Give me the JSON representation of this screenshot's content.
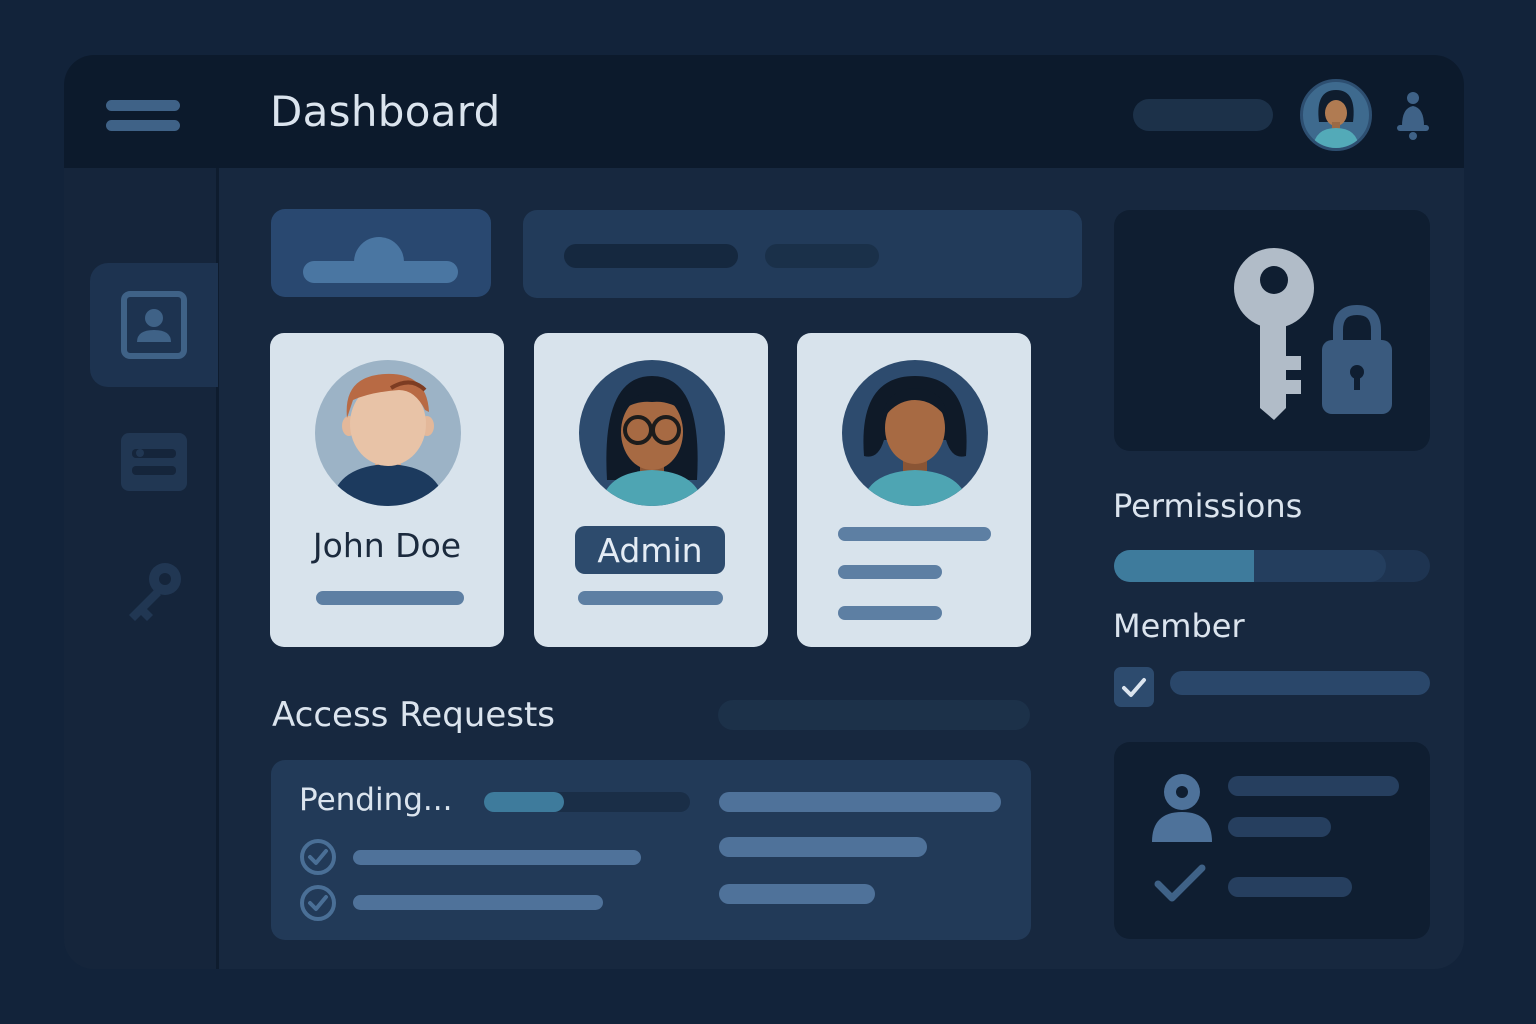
{
  "header": {
    "title": "Dashboard",
    "menu_icon": "hamburger-menu-icon",
    "bell_icon": "bell-icon"
  },
  "sidebar": {
    "items": [
      {
        "icon": "user-profile-icon",
        "active": true
      },
      {
        "icon": "id-card-icon",
        "active": false
      },
      {
        "icon": "key-icon",
        "active": false
      }
    ]
  },
  "users": [
    {
      "name": "John Doe"
    },
    {
      "role": "Admin"
    },
    {}
  ],
  "access_requests": {
    "title": "Access Requests",
    "status": "Pending...",
    "progress": 0.39
  },
  "permissions": {
    "label": "Permissions",
    "progress": 0.45
  },
  "member": {
    "label": "Member",
    "checked": true
  },
  "colors": {
    "accent": "#3e7b9c",
    "background": "#12233a",
    "card": "#d8e3ec",
    "badge": "#2d4b6d"
  }
}
